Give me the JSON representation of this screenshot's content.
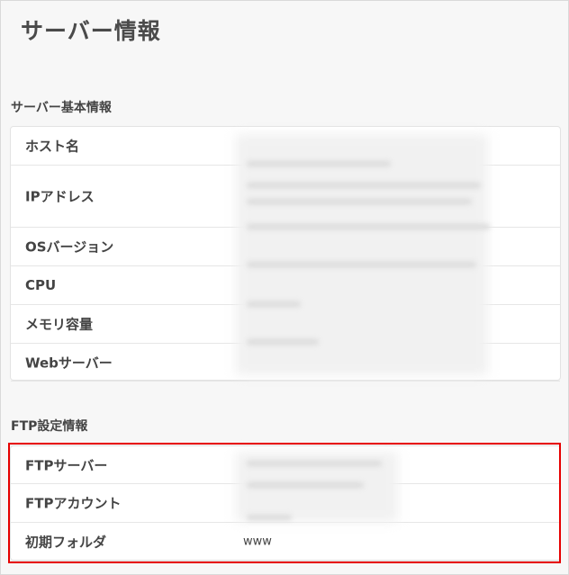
{
  "page": {
    "title": "サーバー情報"
  },
  "server_basic": {
    "title": "サーバー基本情報",
    "rows": [
      {
        "label": "ホスト名"
      },
      {
        "label": "IPアドレス"
      },
      {
        "label": "OSバージョン"
      },
      {
        "label": "CPU"
      },
      {
        "label": "メモリ容量"
      },
      {
        "label": "Webサーバー"
      }
    ]
  },
  "ftp": {
    "title": "FTP設定情報",
    "rows": [
      {
        "label": "FTPサーバー"
      },
      {
        "label": "FTPアカウント"
      },
      {
        "label": "初期フォルダ",
        "value": "www"
      }
    ]
  },
  "colors": {
    "highlight_border": "#e60000",
    "background": "#f7f7f7",
    "card": "#ffffff"
  }
}
